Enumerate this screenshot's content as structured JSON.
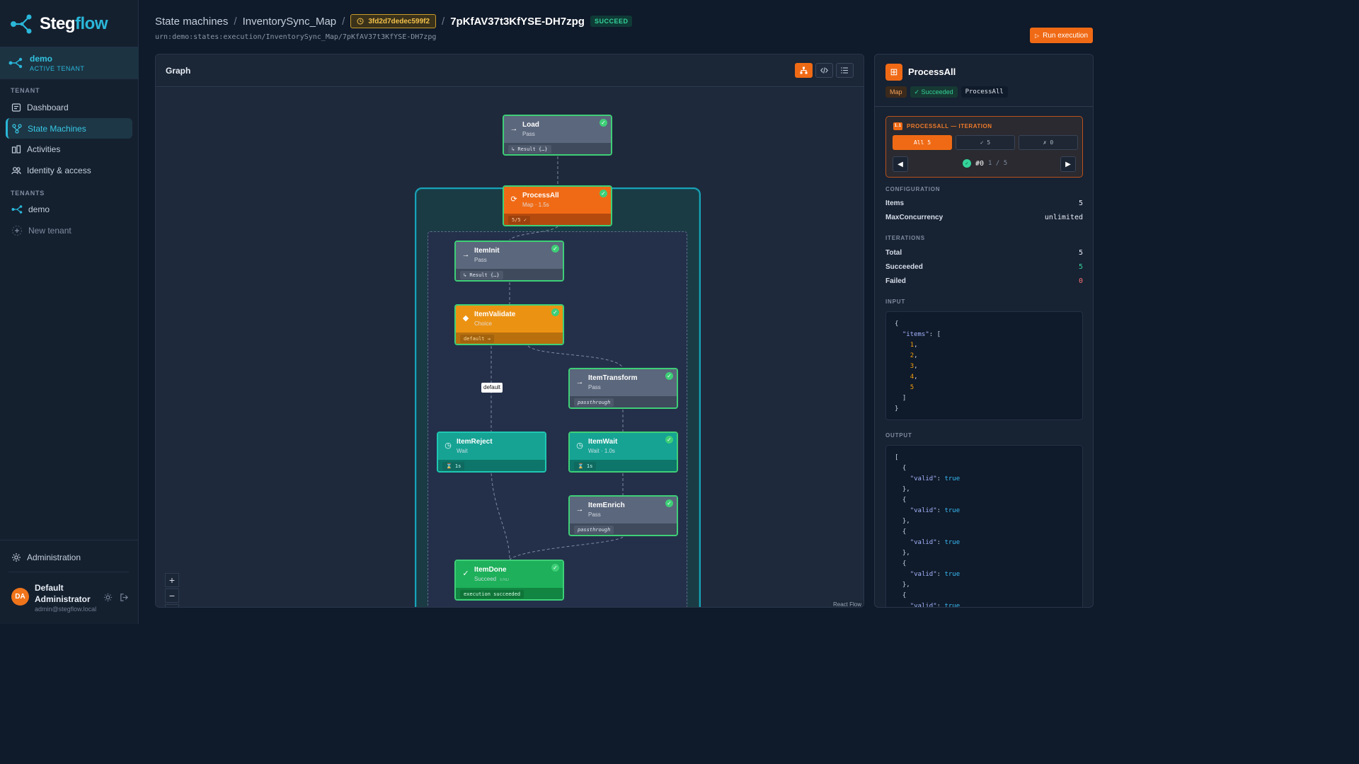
{
  "app": {
    "name_a": "Steg",
    "name_b": "flow"
  },
  "tenant": {
    "name": "demo",
    "sub": "ACTIVE TENANT"
  },
  "sidebar": {
    "section_tenant": "TENANT",
    "items": [
      {
        "label": "Dashboard",
        "icon": "dashboard-icon"
      },
      {
        "label": "State Machines",
        "icon": "state-machine-icon",
        "active": true
      },
      {
        "label": "Activities",
        "icon": "activities-icon"
      },
      {
        "label": "Identity & access",
        "icon": "users-icon"
      }
    ],
    "section_tenants": "TENANTS",
    "tenants": [
      {
        "label": "demo"
      }
    ],
    "new_tenant": "New tenant",
    "admin": "Administration"
  },
  "user": {
    "initials": "DA",
    "name": "Default Administrator",
    "email": "admin@stegflow.local"
  },
  "header": {
    "crumb1": "State machines",
    "crumb2": "InventorySync_Map",
    "hash": "3fd2d7dedec599f2",
    "exec_id": "7pKfAV37t3KfYSE-DH7zpg",
    "status": "SUCCEED",
    "urn": "urn:demo:states:execution/InventorySync_Map/7pKfAV37t3KfYSE-DH7zpg",
    "run_button": "Run execution"
  },
  "graph": {
    "title": "Graph",
    "edge_label": "default",
    "attribution": "React Flow",
    "nodes": {
      "load": {
        "name": "Load",
        "type": "Pass",
        "chip": "↳ Result {…}"
      },
      "processall": {
        "name": "ProcessAll",
        "type": "Map · 1.5s",
        "chip": "5/5 ✓"
      },
      "iteminit": {
        "name": "ItemInit",
        "type": "Pass",
        "chip": "↳ Result {…}"
      },
      "itemvalidate": {
        "name": "ItemValidate",
        "type": "Choice",
        "chip": "default →"
      },
      "itemtransform": {
        "name": "ItemTransform",
        "type": "Pass",
        "chip": "passthrough"
      },
      "itemreject": {
        "name": "ItemReject",
        "type": "Wait",
        "chip": "⌛ 1s"
      },
      "itemwait": {
        "name": "ItemWait",
        "type": "Wait · 1.0s",
        "chip": "⌛ 1s"
      },
      "itemenrich": {
        "name": "ItemEnrich",
        "type": "Pass",
        "chip": "passthrough"
      },
      "itemdone": {
        "name": "ItemDone",
        "type": "Succeed",
        "end": "END",
        "chip": "execution succeeded"
      }
    }
  },
  "panel": {
    "title": "ProcessAll",
    "tag_type": "Map",
    "tag_status": "✓ Succeeded",
    "tag_name": "ProcessAll",
    "iteration": {
      "title": "PROCESSALL — ITERATION",
      "seg_all": "All 5",
      "seg_ok": "✓ 5",
      "seg_fail": "✗ 0",
      "current": "#0",
      "total": "1 / 5"
    },
    "config_label": "CONFIGURATION",
    "config": [
      {
        "k": "Items",
        "v": "5"
      },
      {
        "k": "MaxConcurrency",
        "v": "unlimited"
      }
    ],
    "iter_label": "ITERATIONS",
    "iterations": [
      {
        "k": "Total",
        "v": "5"
      },
      {
        "k": "Succeeded",
        "v": "5"
      },
      {
        "k": "Failed",
        "v": "0"
      }
    ],
    "input_label": "INPUT",
    "output_label": "OUTPUT"
  },
  "colors": {
    "accent": "#f06a15",
    "brand": "#2ab7d9",
    "success": "#34d399",
    "danger": "#f87171"
  }
}
